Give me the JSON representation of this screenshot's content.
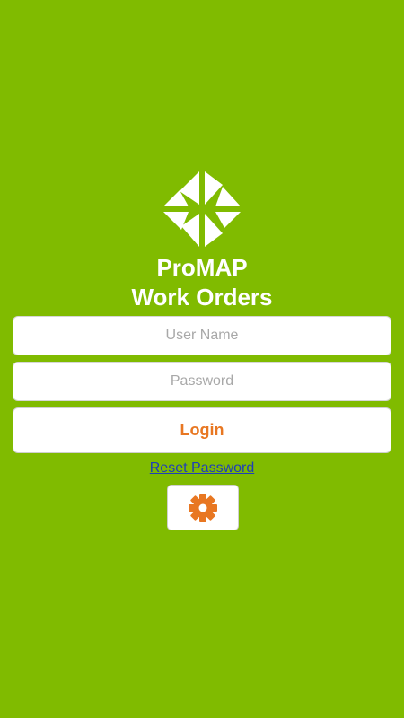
{
  "app": {
    "title_line1": "ProMAP",
    "title_line2": "Work Orders"
  },
  "form": {
    "username": {
      "placeholder": "User Name",
      "value": ""
    },
    "password": {
      "placeholder": "Password",
      "value": ""
    },
    "login_label": "Login",
    "reset_label": "Reset Password"
  },
  "icons": {
    "logo": "pinwheel-logo-icon",
    "settings": "gear-icon"
  },
  "colors": {
    "background": "#80bb00",
    "accent": "#e87722",
    "link": "#1f3fb8",
    "text_light": "#ffffff"
  }
}
